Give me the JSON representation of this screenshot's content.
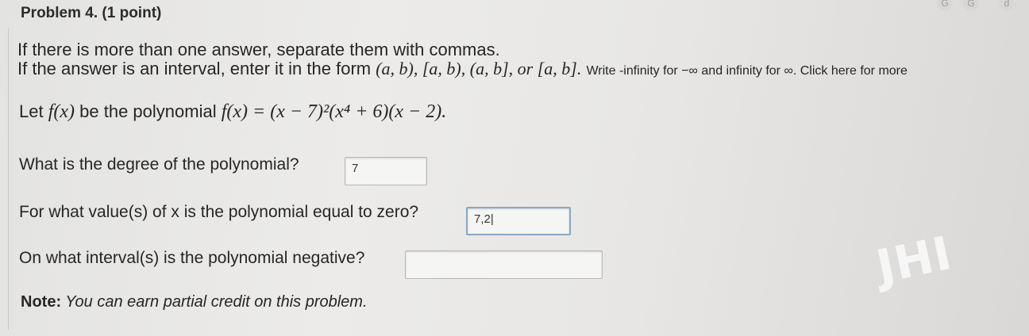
{
  "problem": {
    "title": "Problem 4. (1 point)"
  },
  "instructions": {
    "line1": "If there is more than one answer, separate them with commas.",
    "line2_start": "If the answer is an interval, enter it in the form ",
    "interval_forms": "(a, b), [a, b), (a, b], or [a, b].",
    "line2_rest": " Write -infinity for −∞ and infinity for ∞. Click here for more"
  },
  "polynomial": {
    "prefix": "Let ",
    "fx": "f(x)",
    "middle": " be the polynomial ",
    "expr": "f(x) = (x − 7)²(x⁴ + 6)(x − 2)."
  },
  "questions": [
    {
      "label": "What is the degree of the polynomial?",
      "answer": "7"
    },
    {
      "label": "For what value(s) of x is the polynomial equal to zero?",
      "answer": "7,2|"
    },
    {
      "label": "On what interval(s) is the polynomial negative?",
      "answer": ""
    }
  ],
  "note": {
    "label": "Note:",
    "text": " You can earn partial credit on this problem."
  },
  "toolbar": {
    "icons": [
      "G",
      "G",
      "d"
    ]
  },
  "watermark": "JHI"
}
